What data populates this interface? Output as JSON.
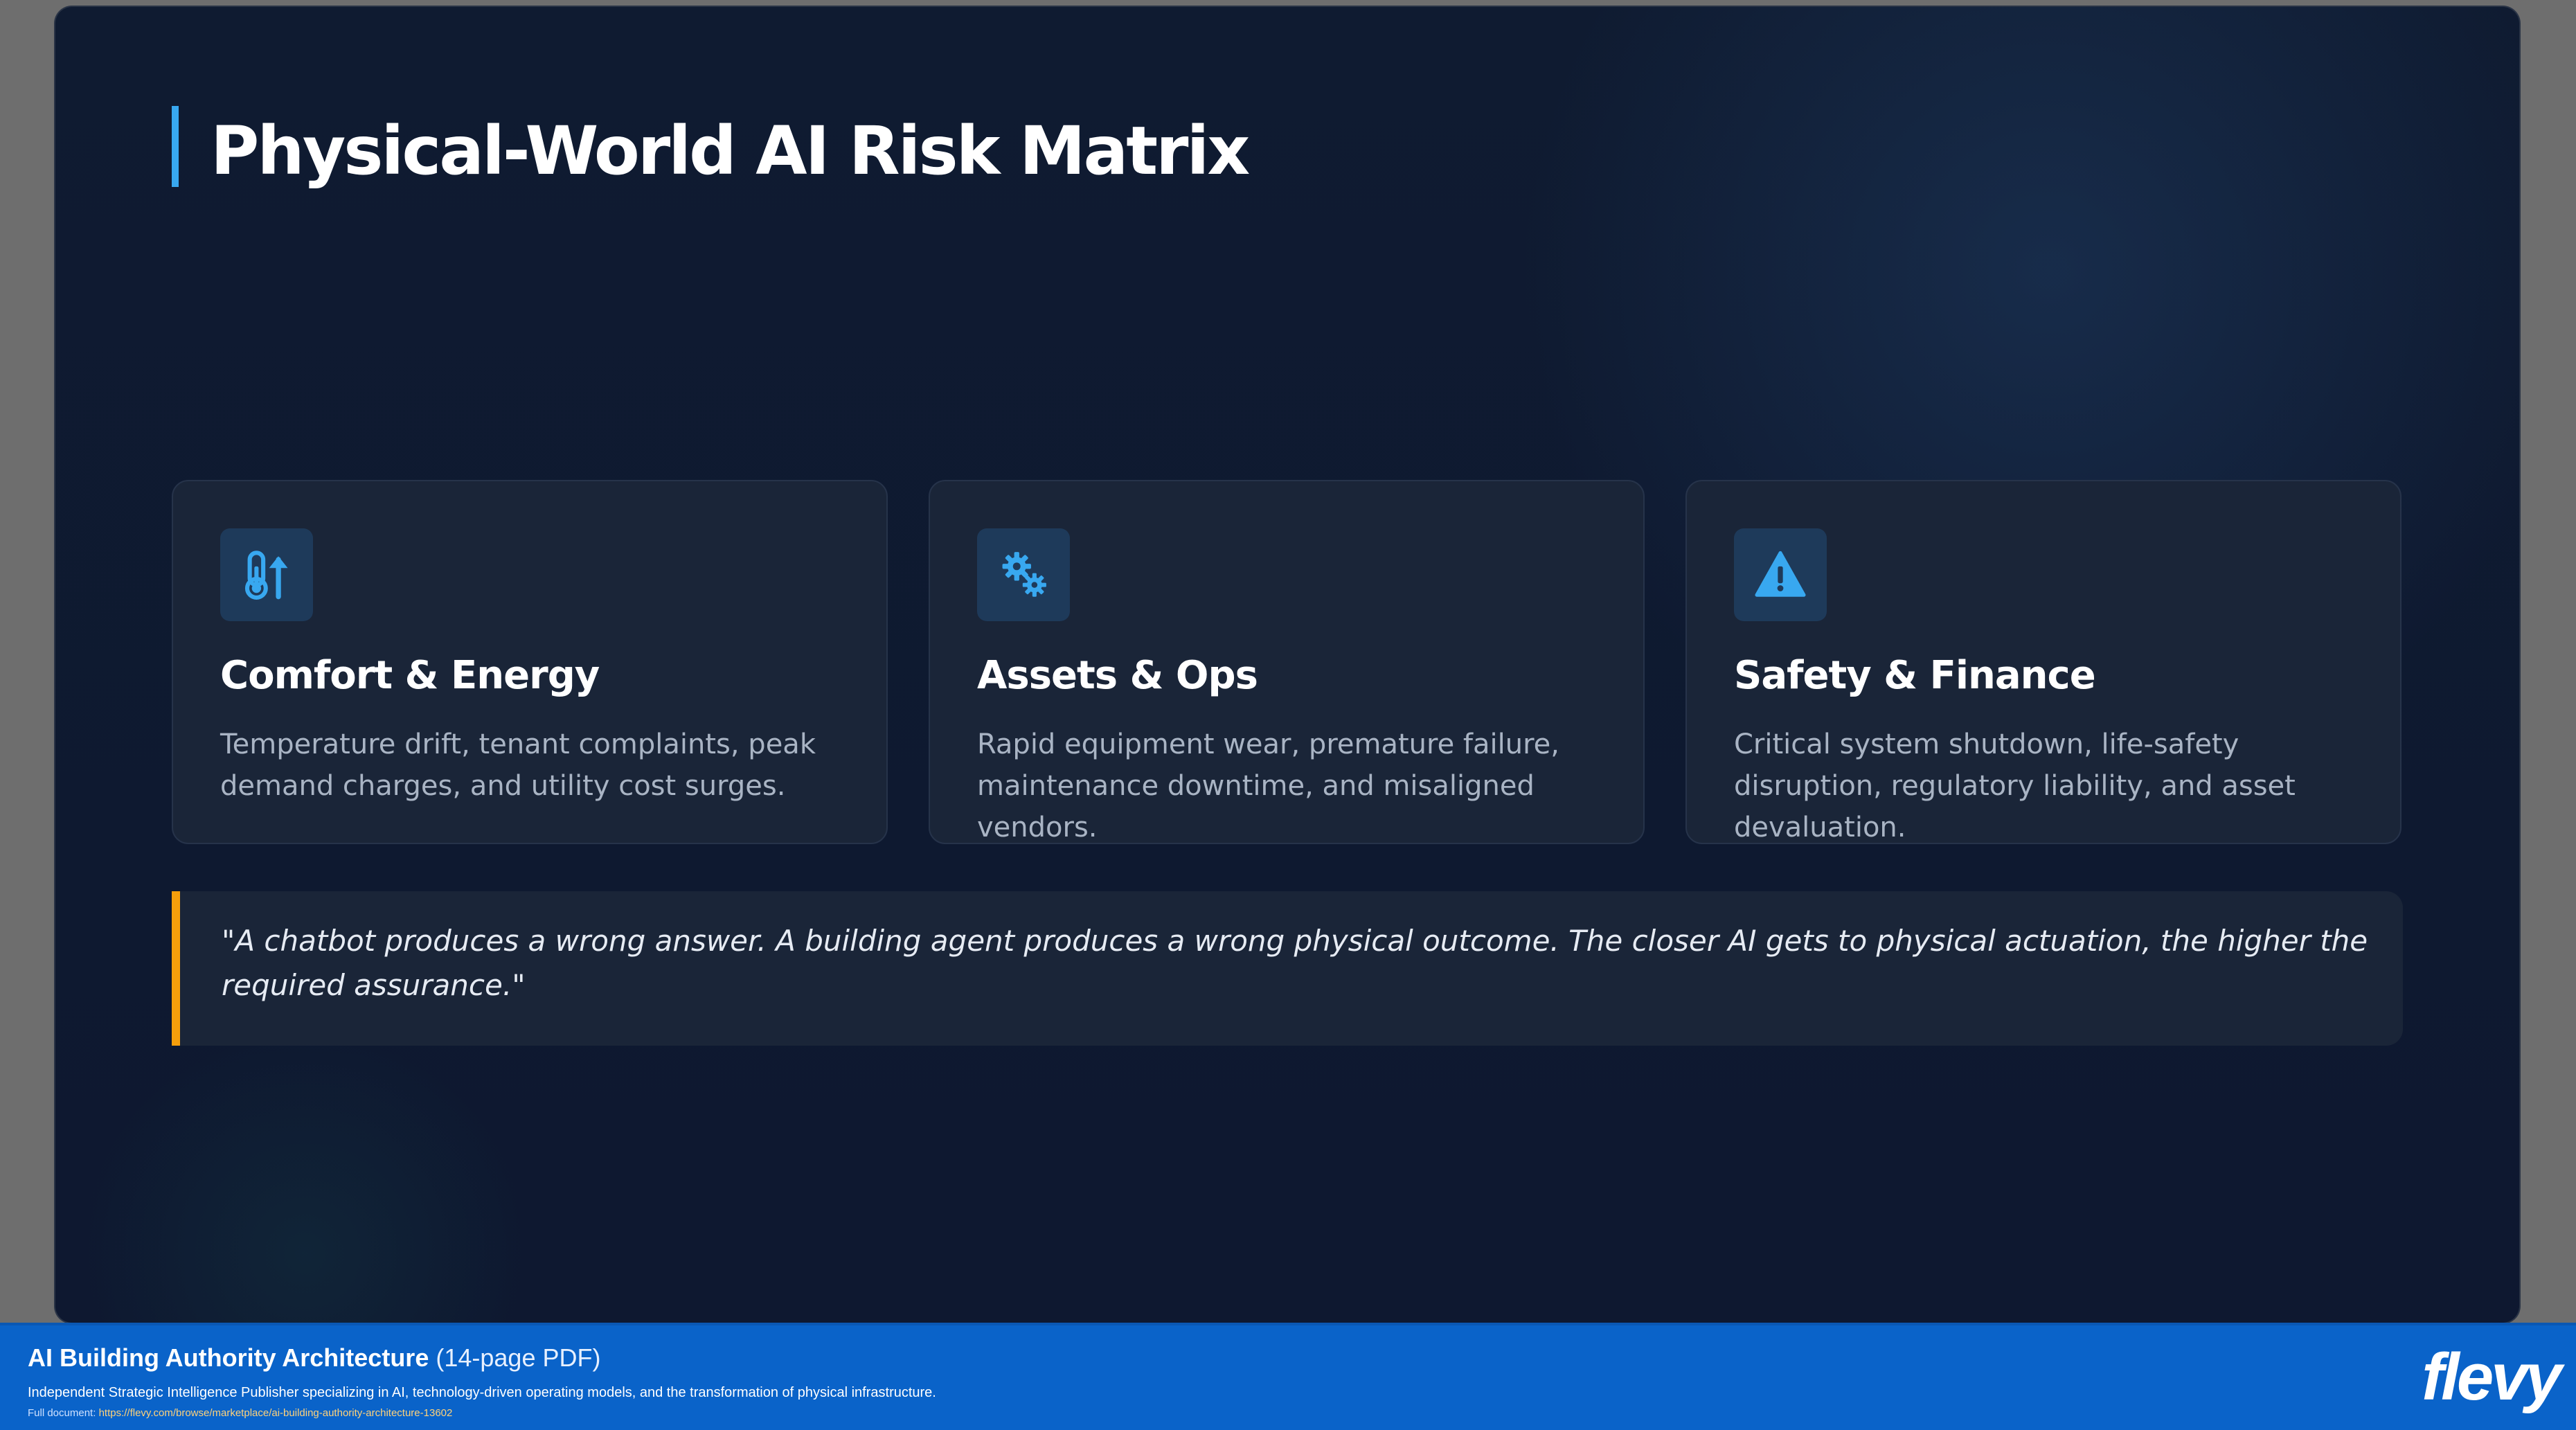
{
  "slide": {
    "title": "Physical-World AI Risk Matrix",
    "accent_color": "#38a8f0",
    "quote_accent_color": "#f59e0b",
    "cards": [
      {
        "icon": "thermometer-arrow-up-icon",
        "title": "Comfort & Energy",
        "text": "Temperature drift, tenant complaints, peak demand charges, and utility cost surges."
      },
      {
        "icon": "gears-icon",
        "title": "Assets & Ops",
        "text": "Rapid equipment wear, premature failure, maintenance downtime, and misaligned vendors."
      },
      {
        "icon": "warning-triangle-icon",
        "title": "Safety & Finance",
        "text": "Critical system shutdown, life-safety disruption, regulatory liability, and asset devaluation."
      }
    ],
    "quote": "\"A chatbot produces a wrong answer. A building agent produces a wrong physical outcome. The closer AI gets to physical actuation, the higher the required assurance.\""
  },
  "footer": {
    "doc_title": "AI Building Authority Architecture",
    "doc_pages": "(14-page PDF)",
    "description": "Independent Strategic Intelligence Publisher specializing in AI, technology-driven operating models, and the transformation of physical infrastructure.",
    "link_label": "Full document:",
    "link_url": "https://flevy.com/browse/marketplace/ai-building-authority-architecture-13602",
    "logo": "flevy",
    "background_color": "#0a63c9"
  }
}
